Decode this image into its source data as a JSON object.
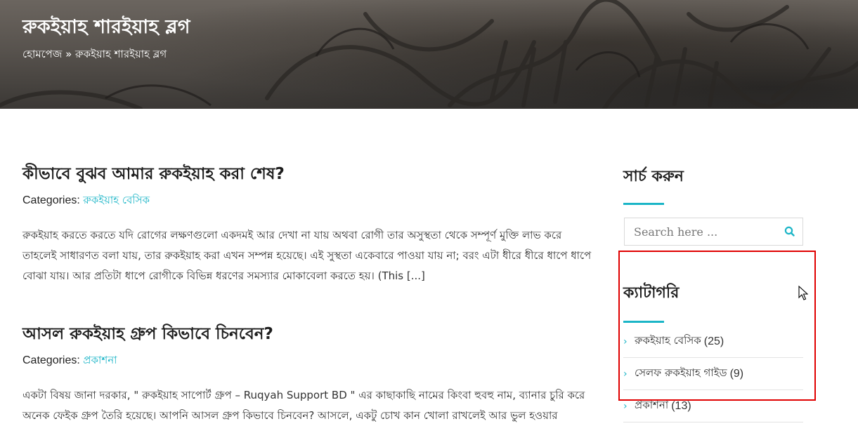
{
  "header": {
    "site_title": "রুকইয়াহ শারইয়াহ ব্লগ",
    "breadcrumb": {
      "home": "হোমপেজ",
      "separator": "»",
      "current": "রুকইয়াহ শারইয়াহ ব্লগ"
    }
  },
  "posts": [
    {
      "title": "কীভাবে বুঝব আমার রুকইয়াহ করা শেষ?",
      "categories_label": "Categories:",
      "category": "রুকইয়াহ বেসিক",
      "excerpt": "রুকইয়াহ করতে করতে যদি রোগের লক্ষণগুলো একদমই আর দেখা না যায় অথবা রোগী তার অসুস্থতা থেকে সম্পূর্ণ মুক্তি লাভ করে তাহলেই সাধারণত বলা যায়, তার রুকইয়াহ করা এখন সম্পন্ন হয়েছে। এই সুস্থতা একেবারে পাওয়া যায় না; বরং এটা ধীরে ধীরে ধাপে ধাপে বোঝা যায়। আর প্রতিটা ধাপে রোগীকে বিভিন্ন ধরণের সমস্যার মোকাবেলা করতে হয়।  (This [...]"
    },
    {
      "title": "আসল রুকইয়াহ গ্রুপ কিভাবে চিনবেন?",
      "categories_label": "Categories:",
      "category": "প্রকাশনা",
      "excerpt": "একটা বিষয় জানা দরকার, \" রুকইয়াহ সাপোর্ট গ্রুপ – Ruqyah Support BD \" এর কাছাকাছি নামের কিংবা হুবহু নাম, ব্যানার চুরি করে অনেক ফেইক গ্রুপ তৈরি হয়েছে। আপনি আসল গ্রুপ কিভাবে চিনবেন? আসলে, একটু চোখ কান খোলা রাখলেই আর ভুল হওয়ার"
    }
  ],
  "sidebar": {
    "search": {
      "title": "সার্চ করুন",
      "placeholder": "Search here ..."
    },
    "categories": {
      "title": "ক্যাটাগরি",
      "items": [
        {
          "label": "রুকইয়াহ বেসিক",
          "count": "(25)"
        },
        {
          "label": "সেলফ রুকইয়াহ গাইড",
          "count": "(9)"
        },
        {
          "label": "প্রকাশনা",
          "count": "(13)"
        }
      ]
    }
  },
  "colors": {
    "accent": "#1bb5c7",
    "highlight_border": "#e00000"
  },
  "icons": [
    "search-icon",
    "chevron-right-icon",
    "cursor-icon"
  ]
}
